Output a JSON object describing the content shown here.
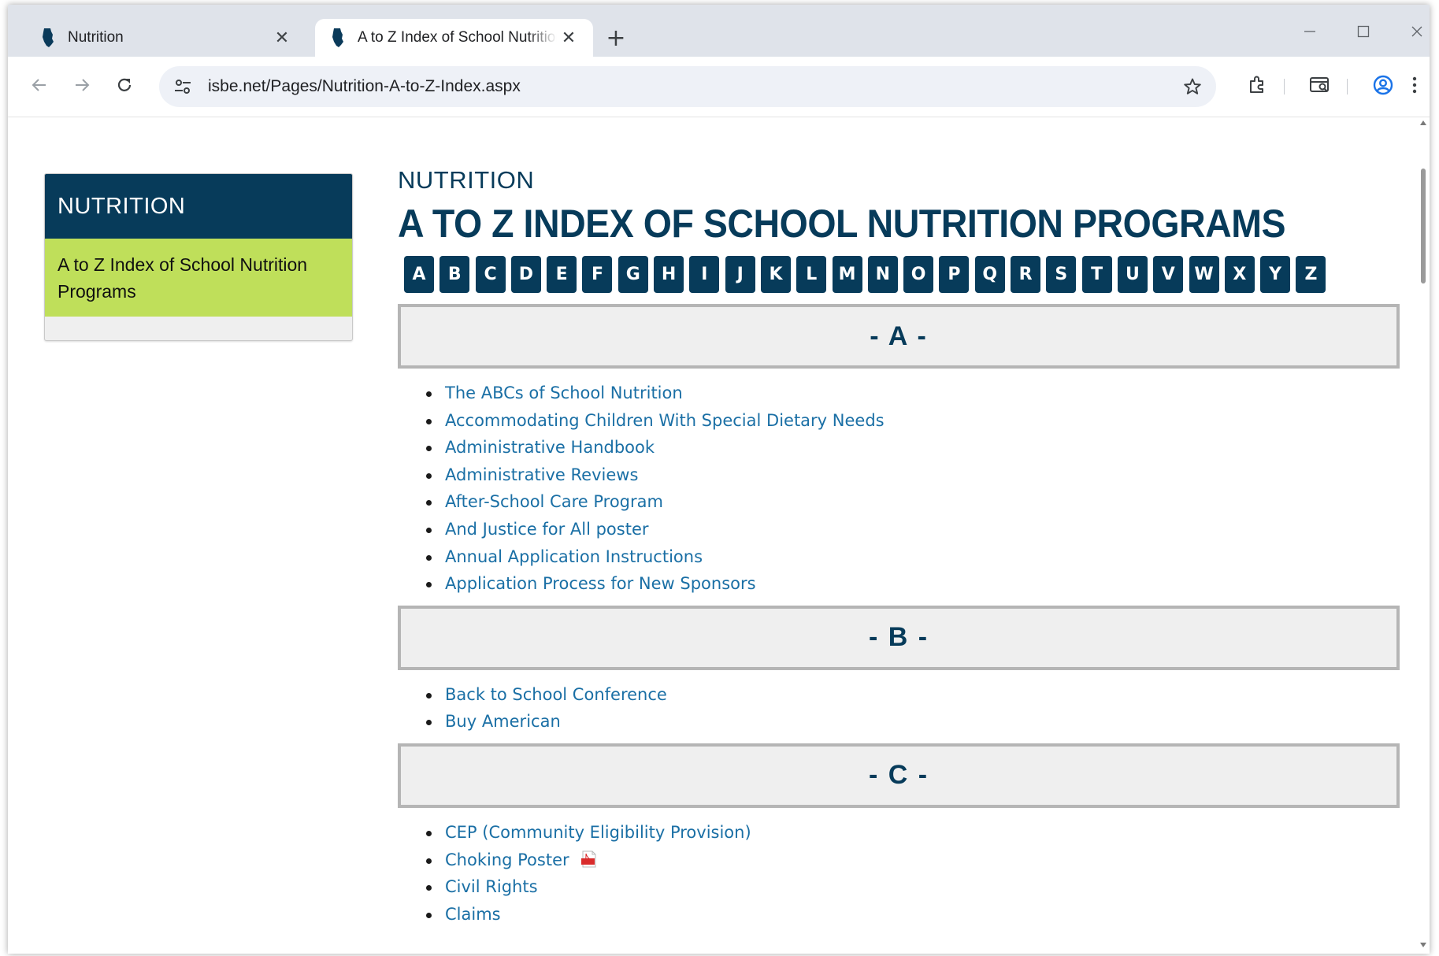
{
  "browser": {
    "tabs": [
      {
        "title": "Nutrition",
        "active": false
      },
      {
        "title": "A to Z Index of School Nutrition Programs",
        "active": true
      }
    ],
    "new_tab": "+",
    "url": "isbe.net/Pages/Nutrition-A-to-Z-Index.aspx"
  },
  "sidebar": {
    "heading": "NUTRITION",
    "items": [
      {
        "label": "A to Z Index of School Nutrition Programs",
        "active": true
      }
    ]
  },
  "main": {
    "eyebrow": "NUTRITION",
    "title": "A TO Z INDEX OF SCHOOL NUTRITION PROGRAMS",
    "letters": [
      "A",
      "B",
      "C",
      "D",
      "E",
      "F",
      "G",
      "H",
      "I",
      "J",
      "K",
      "L",
      "M",
      "N",
      "O",
      "P",
      "Q",
      "R",
      "S",
      "T",
      "U",
      "V",
      "W",
      "X",
      "Y",
      "Z"
    ],
    "sections": [
      {
        "heading": "- A -",
        "links": [
          "The ABCs of School Nutrition",
          "Accommodating Children With Special Dietary Needs",
          "Administrative Handbook",
          "Administrative Reviews",
          "After-School Care Program",
          "And Justice for All poster",
          "Annual Application Instructions",
          "Application Process for New Sponsors"
        ]
      },
      {
        "heading": "- B -",
        "links": [
          "Back to School Conference",
          "Buy American"
        ]
      },
      {
        "heading": "- C -",
        "links": [
          "CEP (Community Eligibility Provision)",
          "Choking Poster",
          "Civil Rights",
          "Claims"
        ]
      }
    ]
  },
  "colors": {
    "brand_navy": "#073b5a",
    "sidebar_active": "#bfdf5a",
    "link": "#1a6fa5",
    "section_bg": "#efefef",
    "section_border": "#b5b5b5"
  },
  "icons": {
    "tab_favicon": "illinois-state-icon",
    "pdf": "pdf-icon"
  }
}
